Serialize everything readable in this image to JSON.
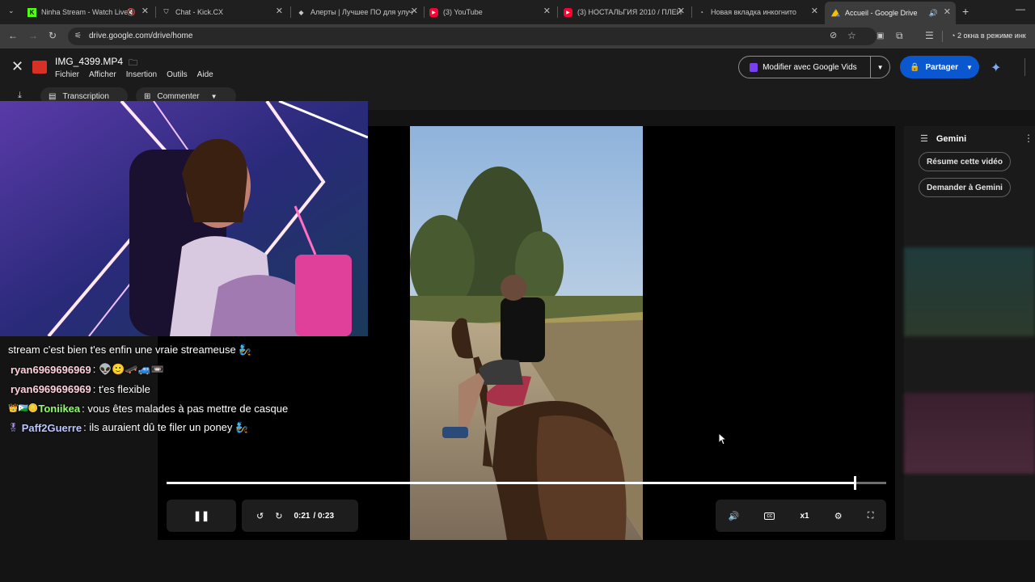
{
  "tabs": [
    {
      "title": "Ninha Stream - Watch Live",
      "favicon": "kick-icon",
      "color": "#53fc18"
    },
    {
      "title": "Chat - Kick.CX",
      "favicon": "shield-icon",
      "color": "#cccccc"
    },
    {
      "title": "Алерты | Лучшее ПО для улуч",
      "favicon": "diamond-icon",
      "color": "#cccccc"
    },
    {
      "title": "(3) YouTube",
      "favicon": "youtube-icon",
      "color": "#ff0033"
    },
    {
      "title": "(3) НОСТАЛЬГИЯ 2010 / ПЛЕЙ",
      "favicon": "youtube-icon",
      "color": "#ff0033"
    },
    {
      "title": "Новая вкладка инкогнито",
      "favicon": "incognito-icon",
      "color": "#cccccc"
    },
    {
      "title": "Accueil - Google Drive",
      "favicon": "drive-icon",
      "color": "#4285f4"
    }
  ],
  "address": {
    "url": "drive.google.com/drive/home",
    "incognito_label": "2 окна в режиме инк"
  },
  "viewer": {
    "filename": "IMG_4399.MP4",
    "menus": [
      "Fichier",
      "Afficher",
      "Insertion",
      "Outils",
      "Aide"
    ],
    "vids_label": "Modifier avec Google Vids",
    "share_label": "Partager",
    "toolbar": {
      "transcript_label": "Transcription",
      "comment_label": "Commenter"
    }
  },
  "player": {
    "current_time": "0:21",
    "duration": "/ 0:23",
    "speed": "x1",
    "progress": 0.9565
  },
  "gemini": {
    "title": "Gemini",
    "chips": [
      "Résume cette vidéo",
      "Demander à Gemini"
    ]
  },
  "chat": [
    {
      "user": "",
      "text": "stream c'est bien t'es enfin une vraie streameuse 🧞",
      "color": "#ffffff"
    },
    {
      "user": "ryan6969696969",
      "text": ": 👽🙂🛹🚙📼",
      "color": "#ffd1dc"
    },
    {
      "user": "ryan6969696969",
      "text": ": t'es flexible",
      "color": "#ffd1dc"
    },
    {
      "user": "Toniikea",
      "text": ": vous êtes malades à pas mettre de casque",
      "color": "#8cff66",
      "badges": "👑🇩🇯🪙"
    },
    {
      "user": "Paff2Guerre",
      "text": ": ils auraient dû te filer un poney 🧞",
      "color": "#b9c6ff",
      "badges": "🎖"
    }
  ]
}
